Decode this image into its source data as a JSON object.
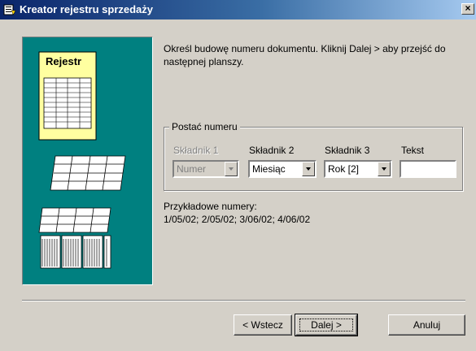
{
  "window": {
    "title": "Kreator rejestru sprzedaży",
    "close_label": "×"
  },
  "illustration": {
    "register_label": "Rejestr"
  },
  "instructions": "Określ budowę numeru dokumentu. Kliknij Dalej > aby przejść do następnej planszy.",
  "number_format": {
    "group_label": "Postać numeru",
    "component1": {
      "label": "Składnik 1",
      "value": "Numer",
      "enabled": false
    },
    "component2": {
      "label": "Składnik 2",
      "value": "Miesiąc",
      "enabled": true
    },
    "component3": {
      "label": "Składnik 3",
      "value": "Rok [2]",
      "enabled": true
    },
    "text": {
      "label": "Tekst",
      "value": ""
    }
  },
  "examples": {
    "label": "Przykładowe numery:",
    "values": "1/05/02; 2/05/02; 3/06/02; 4/06/02"
  },
  "buttons": {
    "back": "< Wstecz",
    "next": "Dalej >",
    "cancel": "Anuluj"
  }
}
